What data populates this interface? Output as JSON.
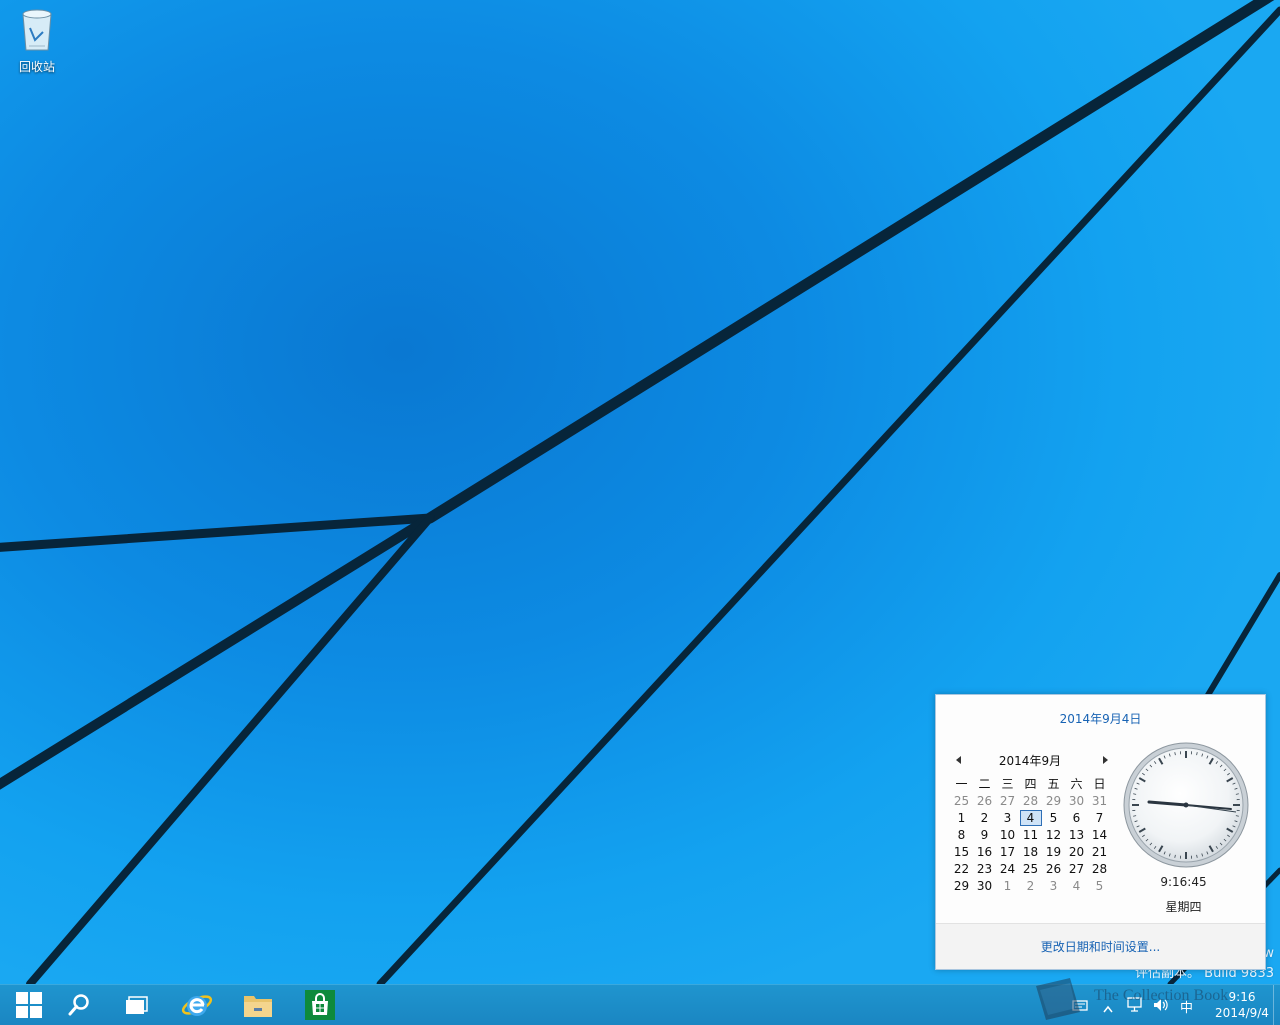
{
  "desktop": {
    "recycle_bin_label": "回收站",
    "watermark_line1": "w",
    "watermark_line2": "评估副本。 Build 9833"
  },
  "taskbar": {
    "buttons": [
      {
        "name": "start-button",
        "icon": "windows-logo-icon"
      },
      {
        "name": "search-button",
        "icon": "search-icon"
      },
      {
        "name": "task-view-button",
        "icon": "task-view-icon"
      },
      {
        "name": "internet-explorer-button",
        "icon": "internet-explorer-icon"
      },
      {
        "name": "file-explorer-button",
        "icon": "folder-icon"
      },
      {
        "name": "store-button",
        "icon": "store-icon"
      }
    ],
    "tray": {
      "ime": "中",
      "clock_time": "9:16",
      "clock_date": "2014/9/4"
    }
  },
  "overlay": {
    "book_text": "The Collection Book"
  },
  "calendar_flyout": {
    "long_date": "2014年9月4日",
    "month_label": "2014年9月",
    "weekdays": [
      "一",
      "二",
      "三",
      "四",
      "五",
      "六",
      "日"
    ],
    "weeks": [
      [
        "25",
        "26",
        "27",
        "28",
        "29",
        "30",
        "31"
      ],
      [
        "1",
        "2",
        "3",
        "4",
        "5",
        "6",
        "7"
      ],
      [
        "8",
        "9",
        "10",
        "11",
        "12",
        "13",
        "14"
      ],
      [
        "15",
        "16",
        "17",
        "18",
        "19",
        "20",
        "21"
      ],
      [
        "22",
        "23",
        "24",
        "25",
        "26",
        "27",
        "28"
      ],
      [
        "29",
        "30",
        "1",
        "2",
        "3",
        "4",
        "5"
      ]
    ],
    "today": "4",
    "time": "9:16:45",
    "weekday": "星期四",
    "change_settings_link": "更改日期和时间设置..."
  },
  "colors": {
    "accent_link": "#1863b4",
    "taskbar": "#1a8ac6"
  }
}
